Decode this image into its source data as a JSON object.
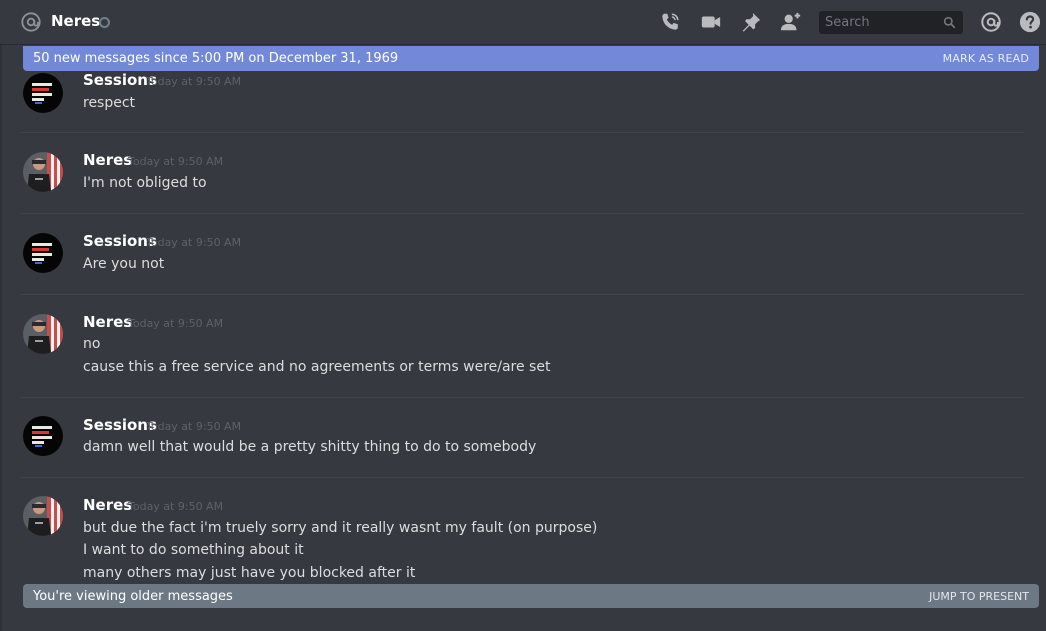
{
  "header": {
    "channel_name": "Neres",
    "search_placeholder": "Search",
    "icons": [
      "at-icon",
      "call-icon",
      "video-icon",
      "pin-icon",
      "add-friend-icon",
      "search-icon",
      "mentions-icon",
      "help-icon"
    ]
  },
  "new_messages_bar": {
    "text": "50 new messages since 5:00 PM on December 31, 1969",
    "action": "MARK AS READ",
    "color": "#7289da"
  },
  "messages": [
    {
      "author": "Sessions",
      "timestamp": "Today at 9:50 AM",
      "lines": [
        "respect"
      ]
    },
    {
      "author": "Neres",
      "timestamp": "Today at 9:50 AM",
      "lines": [
        "I'm not obliged to"
      ]
    },
    {
      "author": "Sessions",
      "timestamp": "Today at 9:50 AM",
      "lines": [
        "Are you not"
      ]
    },
    {
      "author": "Neres",
      "timestamp": "Today at 9:50 AM",
      "lines": [
        "no",
        "cause this a free service and no agreements or terms were/are set"
      ]
    },
    {
      "author": "Sessions",
      "timestamp": "Today at 9:50 AM",
      "lines": [
        "damn well that would be a pretty shitty thing to do to somebody"
      ]
    },
    {
      "author": "Neres",
      "timestamp": "Today at 9:50 AM",
      "lines": [
        "but due the fact i'm truely sorry and it really wasnt my fault (on purpose)",
        "I want to do something about it",
        "many others may just have you blocked after it"
      ]
    }
  ],
  "older_bar": {
    "text": "You're viewing older messages",
    "action": "JUMP TO PRESENT",
    "color": "#6d7885"
  }
}
